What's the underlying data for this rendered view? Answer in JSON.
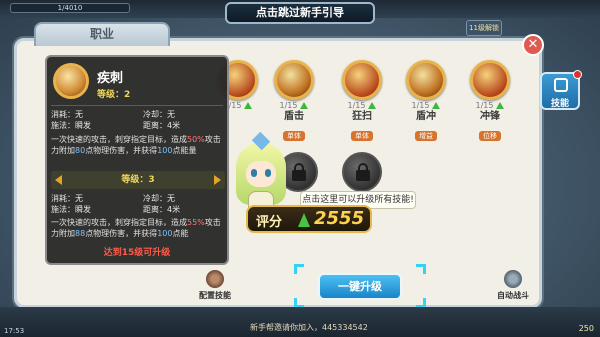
{
  "top_bar": {
    "hp_text": "1/4010"
  },
  "guide": {
    "label": "点击跳过新手引导"
  },
  "right_badge": "11级解锁",
  "panel": {
    "tab_label": "职业",
    "side_tab_label": "技能",
    "close_label": "✕"
  },
  "skills": [
    {
      "name": "",
      "level": "1/15",
      "tag": "",
      "icon": "sword-icon"
    },
    {
      "name": "盾击",
      "level": "1/15",
      "tag": "单体",
      "icon": "shield-bash-icon"
    },
    {
      "name": "狂扫",
      "level": "1/15",
      "tag": "单体",
      "icon": "sweep-icon"
    },
    {
      "name": "盾冲",
      "level": "1/15",
      "tag": "增益",
      "icon": "shield-charge-icon"
    },
    {
      "name": "冲锋",
      "level": "1/15",
      "tag": "位移",
      "icon": "charge-icon"
    }
  ],
  "tooltip": {
    "name": "疾刺",
    "level": "等级：2",
    "cost": "消耗：无",
    "cooldown": "冷却：无",
    "cast": "施法：瞬发",
    "range": "距离：4米",
    "desc1_a": "一次快速的攻击，刺穿指定目标，造成",
    "desc1_v1": "50%",
    "desc1_b": "攻击力附加",
    "desc1_v2": "80",
    "desc1_c": "点物理伤害，并获得",
    "desc1_v3": "100",
    "desc1_d": "点能量",
    "next_level": "等级：3",
    "cost2": "消耗：无",
    "cooldown2": "冷却：无",
    "cast2": "施法：瞬发",
    "range2": "距离：4米",
    "desc2_a": "一次快速的攻击，刺穿指定目标，造成",
    "desc2_v1": "55%",
    "desc2_b": "攻击力附加",
    "desc2_v2": "88",
    "desc2_c": "点物理伤害，并获得",
    "desc2_v3": "100",
    "desc2_d": "点能",
    "requirement": "达到15级可升级"
  },
  "hint": "点击这里可以升级所有技能!",
  "score": {
    "label": "评分",
    "value": "2555"
  },
  "actions": {
    "config_label": "配置技能",
    "upgrade_label": "一键升级",
    "auto_label": "自动战斗"
  },
  "bottom": {
    "left_num": "17:53",
    "chat": "新手帮邀请你加入，445334542",
    "right_num": "250"
  },
  "colors": {
    "accent": "#1b84c7",
    "score_gold": "#ffd34a",
    "warning": "#ff5a4a"
  }
}
